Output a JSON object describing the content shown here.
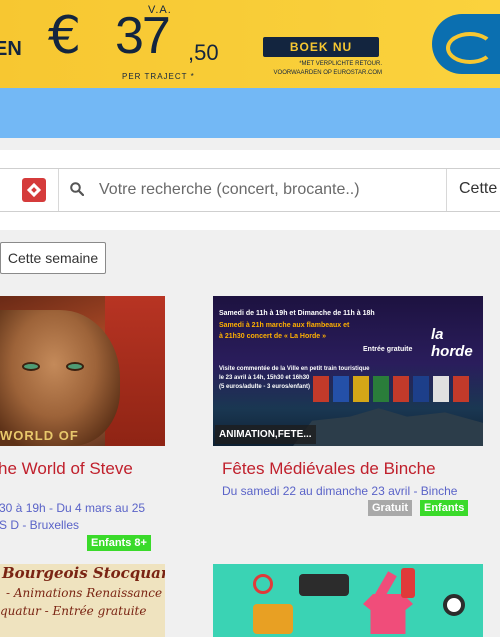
{
  "banner": {
    "left_text": "EN",
    "va": "V.A.",
    "euro_symbol": "€",
    "price_main": "37",
    "price_cents": ",50",
    "per_trip": "PER TRAJECT *",
    "book_label": "BOEK NU",
    "terms": "*MET VERPLICHTE RETOUR. VOORWAARDEN OP EUROSTAR.COM",
    "colors": {
      "background": "#f7c731",
      "navy": "#13253f"
    }
  },
  "search": {
    "placeholder": "Votre recherche (concert, brocante..)",
    "right_label": "Cette"
  },
  "filter": {
    "week_label": "Cette semaine"
  },
  "events": [
    {
      "image_caption": "WORLD OF",
      "title": "he World of Steve",
      "date": "30 à 19h - Du 4 mars au 25",
      "location": "S D - Bruxelles",
      "badges": [
        "Enfants 8+"
      ]
    },
    {
      "image_tag": "ANIMATION,FETE...",
      "image_lines": [
        "Samedi de 11h à 19h et Dimanche de 11h à 18h",
        "Samedi à 21h marche aux flambeaux et",
        "à 21h30 concert de « La Horde »",
        "Entrée gratuite",
        "Visite commentée de la Ville en petit train touristique",
        "le 23 avril à 14h, 15h30 et 16h30",
        "(5 euros/adulte - 3 euros/enfant)"
      ],
      "image_logo": "la horde",
      "title": "Fêtes Médiévales de Binche",
      "date": "Du samedi 22 au dimanche 23 avril - Binche",
      "badges": [
        "Gratuit",
        "Enfants"
      ]
    }
  ],
  "bottom_cards": [
    {
      "lines": [
        "Bourgeois Stocquarts",
        "- Animations Renaissance",
        "quatur - Entrée gratuite"
      ]
    },
    {}
  ],
  "colors": {
    "accent_red": "#c0202c",
    "link_blue": "#5a63c8",
    "badge_green": "#3ada2a",
    "badge_gray": "#a9a9a9",
    "top_bar": "#73b8f5"
  }
}
